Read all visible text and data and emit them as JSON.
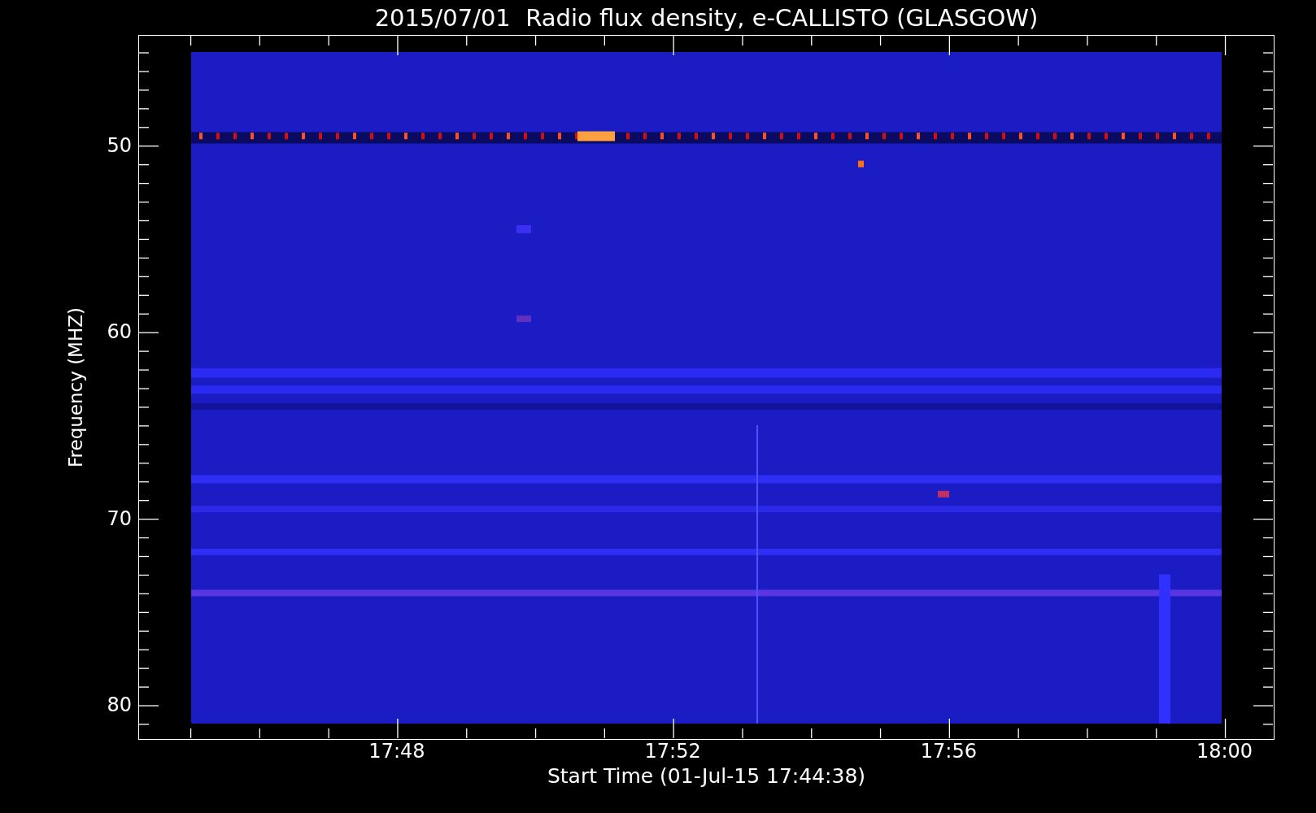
{
  "plot": {
    "title": "2015/07/01  Radio flux density, e-CALLISTO (GLASGOW)",
    "y_axis": {
      "label": "Frequency (MHZ)",
      "ticks": [
        "50",
        "60",
        "70",
        "80"
      ]
    },
    "x_axis": {
      "label": "Start Time (01-Jul-15 17:44:38)",
      "ticks": [
        "17:48",
        "17:52",
        "17:56",
        "18:00"
      ]
    }
  }
}
